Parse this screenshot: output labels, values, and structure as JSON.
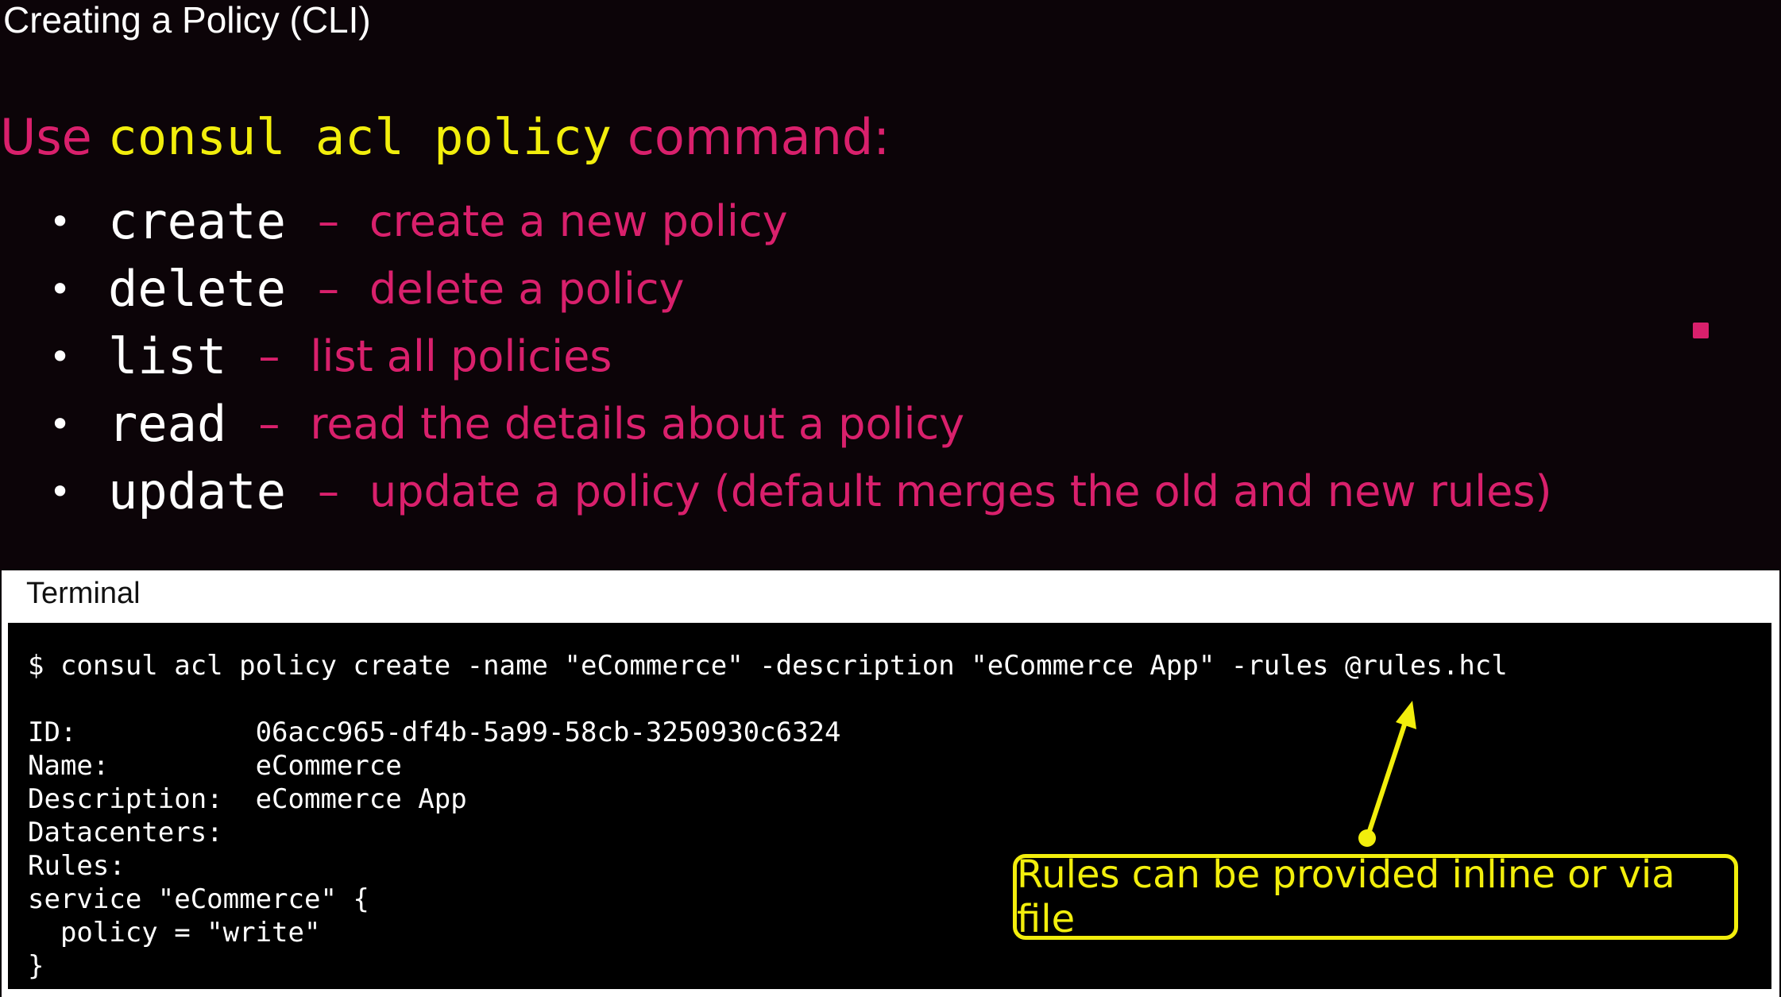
{
  "slide": {
    "title": "Creating a Policy (CLI)"
  },
  "intro": {
    "prefix": "Use",
    "command": "consul acl policy",
    "suffix": "command:"
  },
  "subcommands": [
    {
      "name": "create",
      "dash": "–",
      "description": "create a new policy"
    },
    {
      "name": "delete",
      "dash": "–",
      "description": "delete a policy"
    },
    {
      "name": "list",
      "dash": "–",
      "description": "list all policies"
    },
    {
      "name": "read",
      "dash": "–",
      "description": "read the details about a policy"
    },
    {
      "name": "update",
      "dash": "–",
      "description": "update a policy (default merges the old and new rules)"
    }
  ],
  "terminal": {
    "title": "Terminal",
    "command": "$ consul acl policy create -name \"eCommerce\" -description \"eCommerce App\" -rules @rules.hcl",
    "output": [
      "ID:           06acc965-df4b-5a99-58cb-3250930c6324",
      "Name:         eCommerce",
      "Description:  eCommerce App",
      "Datacenters:",
      "Rules:",
      "service \"eCommerce\" {",
      "  policy = \"write\"",
      "}"
    ]
  },
  "callout": {
    "text": "Rules can be provided inline or via file"
  },
  "colors": {
    "background": "#0c0408",
    "accent_pink": "#d9206c",
    "accent_yellow": "#f2ee0c"
  }
}
